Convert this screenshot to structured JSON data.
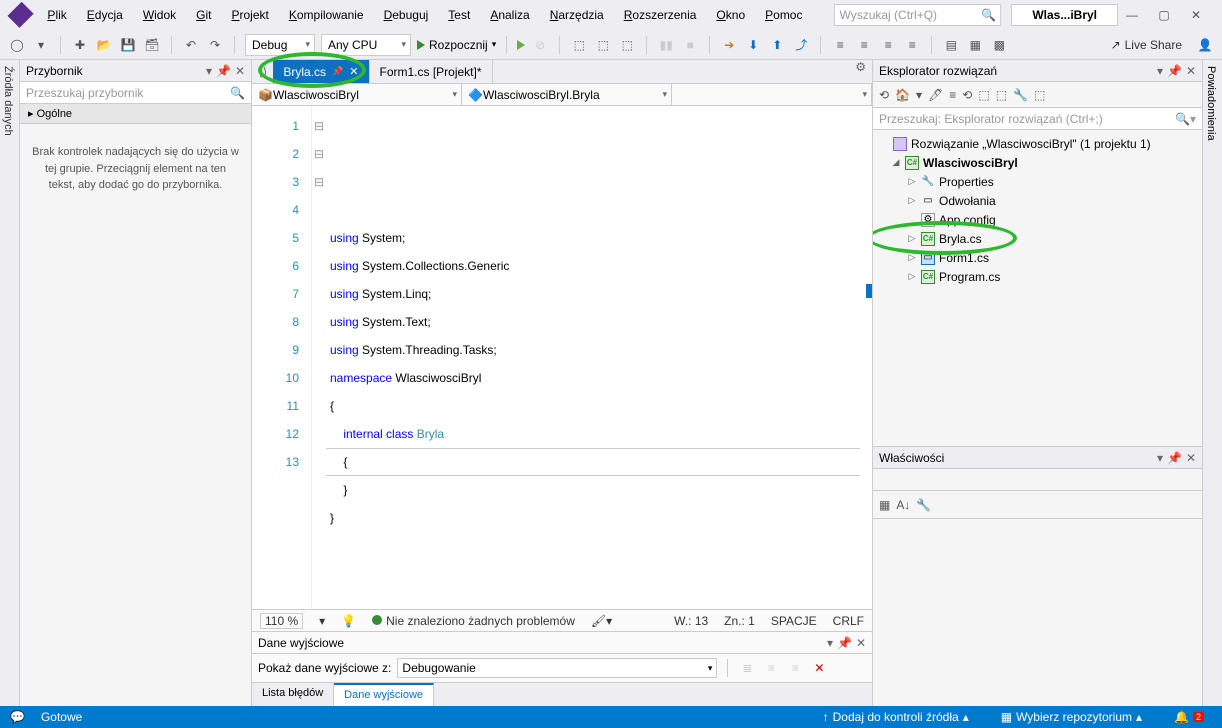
{
  "menu": [
    "Plik",
    "Edycja",
    "Widok",
    "Git",
    "Projekt",
    "Kompilowanie",
    "Debuguj",
    "Test",
    "Analiza",
    "Narzędzia",
    "Rozszerzenia",
    "Okno",
    "Pomoc"
  ],
  "searchPlaceholder": "Wyszukaj (Ctrl+Q)",
  "titleTab": "Wlas...iBryl",
  "config": "Debug",
  "platform": "Any CPU",
  "runLabel": "Rozpocznij",
  "liveShare": "Live Share",
  "leftRail": "Źródła danych",
  "rightRail": "Powiadomienia",
  "toolbox": {
    "title": "Przybornik",
    "search": "Przeszukaj przybornik",
    "category": "▸ Ogólne",
    "msg": "Brak kontrolek nadających się do użycia w tej grupie. Przeciągnij element na ten tekst, aby dodać go do przybornika."
  },
  "tabs": [
    {
      "label": "Bryla.cs",
      "active": true
    },
    {
      "label": "Form1.cs [Projekt]*",
      "active": false
    }
  ],
  "nav1": "WlasciwosciBryl",
  "nav2": "WlasciwosciBryl.Bryla",
  "code": {
    "lines": [
      "1",
      "2",
      "3",
      "4",
      "5",
      "6",
      "7",
      "8",
      "9",
      "10",
      "11",
      "12",
      "13"
    ],
    "fold": [
      "⊟",
      "",
      "",
      "",
      "",
      "",
      "⊟",
      "",
      "⊟",
      "",
      "",
      "",
      ""
    ],
    "tokens": [
      [
        {
          "t": "using ",
          "c": "kw"
        },
        {
          "t": "System;",
          "c": ""
        }
      ],
      [
        {
          "t": "using ",
          "c": "kw"
        },
        {
          "t": "System.Collections.Generic",
          "c": ""
        }
      ],
      [
        {
          "t": "using ",
          "c": "kw"
        },
        {
          "t": "System.Linq;",
          "c": ""
        }
      ],
      [
        {
          "t": "using ",
          "c": "kw"
        },
        {
          "t": "System.Text;",
          "c": ""
        }
      ],
      [
        {
          "t": "using ",
          "c": "kw"
        },
        {
          "t": "System.Threading.Tasks;",
          "c": ""
        }
      ],
      [
        {
          "t": "",
          "c": ""
        }
      ],
      [
        {
          "t": "namespace ",
          "c": "kw"
        },
        {
          "t": "WlasciwosciBryl",
          "c": ""
        }
      ],
      [
        {
          "t": "{",
          "c": ""
        }
      ],
      [
        {
          "t": "    ",
          "c": ""
        },
        {
          "t": "internal class ",
          "c": "kw"
        },
        {
          "t": "Bryla",
          "c": "type"
        }
      ],
      [
        {
          "t": "    {",
          "c": ""
        }
      ],
      [
        {
          "t": "    }",
          "c": ""
        }
      ],
      [
        {
          "t": "}",
          "c": ""
        }
      ],
      [
        {
          "t": "",
          "c": ""
        }
      ]
    ]
  },
  "edStatus": {
    "zoom": "110 %",
    "msg": "Nie znaleziono żadnych problemów",
    "line": "W.:  13",
    "col": "Zn.: 1",
    "spaces": "SPACJE",
    "eol": "CRLF"
  },
  "output": {
    "title": "Dane wyjściowe",
    "label": "Pokaż dane wyjściowe z:",
    "combo": "Debugowanie"
  },
  "bottomTabs": [
    "Lista błędów",
    "Dane wyjściowe"
  ],
  "solExp": {
    "title": "Eksplorator rozwiązań",
    "search": "Przeszukaj: Eksplorator rozwiązań (Ctrl+;)",
    "sln": "Rozwiązanie „WlasciwosciBryl\" (1 projektu 1)",
    "proj": "WlasciwosciBryl",
    "items": [
      "Properties",
      "Odwołania",
      "App.config",
      "Bryla.cs",
      "Form1.cs",
      "Program.cs"
    ]
  },
  "props": {
    "title": "Właściwości"
  },
  "status": {
    "ready": "Gotowe",
    "add": "Dodaj do kontroli źródła",
    "repo": "Wybierz repozytorium",
    "notif": "2"
  }
}
